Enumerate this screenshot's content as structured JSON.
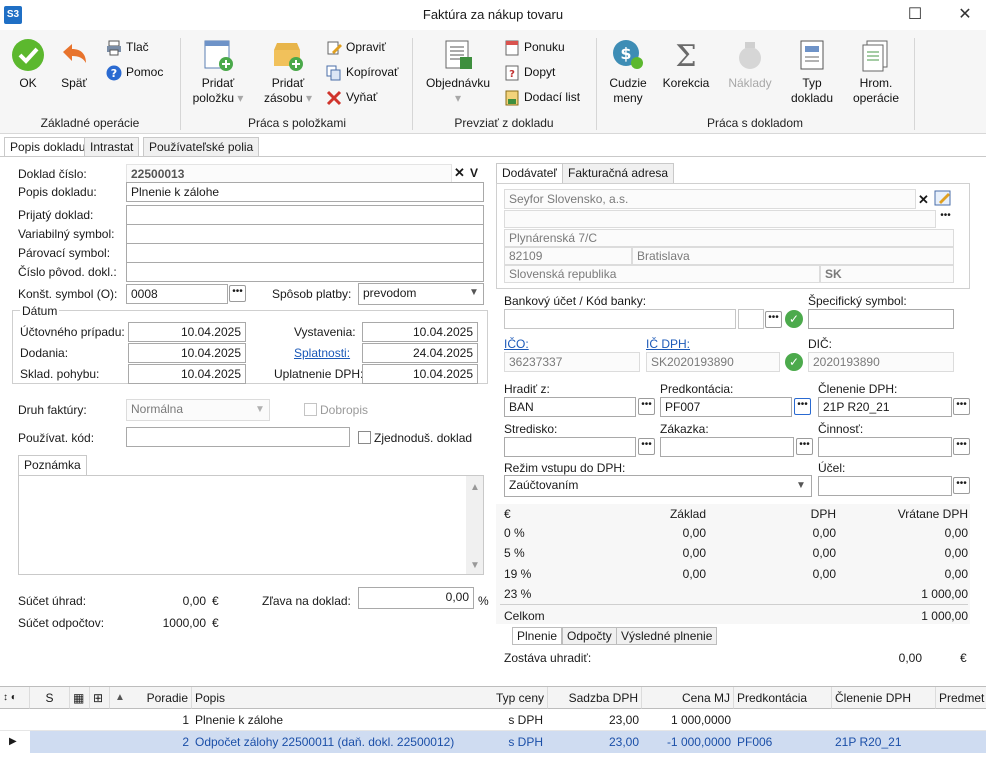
{
  "window": {
    "logo": "S3",
    "title": "Faktúra za nákup tovaru"
  },
  "ribbon": {
    "ok": "OK",
    "back": "Späť",
    "print": "Tlač",
    "help": "Pomoc",
    "add_item_l1": "Pridať",
    "add_item_l2": "položku",
    "add_stock_l1": "Pridať",
    "add_stock_l2": "zásobu",
    "edit": "Opraviť",
    "copy": "Kopírovať",
    "cut": "Vyňať",
    "order": "Objednávku",
    "offer": "Ponuku",
    "inquiry": "Dopyt",
    "delivery_note": "Dodací list",
    "currency_l1": "Cudzie",
    "currency_l2": "meny",
    "correction": "Korekcia",
    "costs": "Náklady",
    "doc_type_l1": "Typ",
    "doc_type_l2": "dokladu",
    "bulk_l1": "Hrom.",
    "bulk_l2": "operácie",
    "groups": {
      "basic": "Základné operácie",
      "items": "Práca s položkami",
      "import": "Prevziať z dokladu",
      "document": "Práca s dokladom"
    }
  },
  "tabs": {
    "description": "Popis dokladu",
    "intrastat": "Intrastat",
    "user_fields": "Používateľské polia"
  },
  "form": {
    "doc_number_label": "Doklad číslo:",
    "doc_number": "22500013",
    "doc_desc_label": "Popis dokladu:",
    "doc_desc": "Plnenie k zálohe",
    "received_label": "Prijatý doklad:",
    "variable_label": "Variabilný symbol:",
    "pairing_label": "Párovací symbol:",
    "orig_label": "Číslo pôvod. dokl.:",
    "const_label": "Konšt. symbol (O):",
    "const_value": "0008",
    "payment_label": "Spôsob platby:",
    "payment_value": "prevodom",
    "date_group": "Dátum",
    "accounting_label": "Účtovného prípadu:",
    "accounting_date": "10.04.2025",
    "delivery_label": "Dodania:",
    "delivery_date": "10.04.2025",
    "stock_label": "Sklad. pohybu:",
    "stock_date": "10.04.2025",
    "issue_label": "Vystavenia:",
    "issue_date": "10.04.2025",
    "due_label": "Splatnosti:",
    "due_date": "24.04.2025",
    "vat_claim_label": "Uplatnenie DPH:",
    "vat_claim_date": "10.04.2025",
    "invoice_kind_label": "Druh faktúry:",
    "invoice_kind": "Normálna",
    "credit_note": "Dobropis",
    "user_code_label": "Používat. kód:",
    "simplified": "Zjednoduš. doklad",
    "note_tab": "Poznámka",
    "payments_sum_label": "Súčet úhrad:",
    "payments_sum": "0,00",
    "payments_cur": "€",
    "deductions_label": "Súčet odpočtov:",
    "deductions_sum": "1000,00",
    "deductions_cur": "€",
    "discount_label": "Zľava na doklad:",
    "discount": "0,00",
    "discount_unit": "%"
  },
  "supplier": {
    "tab_supplier": "Dodávateľ",
    "tab_billing": "Fakturačná adresa",
    "name": "Seyfor Slovensko, a.s.",
    "street": "Plynárenská 7/C",
    "zip": "82109",
    "city": "Bratislava",
    "country": "Slovenská republika",
    "country_code": "SK",
    "bank_label": "Bankový účet / Kód banky:",
    "specific_label": "Špecifický symbol:",
    "ico_label": "IČO:",
    "ico": "36237337",
    "icdph_label": "IČ DPH:",
    "icdph": "SK2020193890",
    "dic_label": "DIČ:",
    "dic": "2020193890",
    "pay_from_label": "Hradiť z:",
    "pay_from": "BAN",
    "precontation_label": "Predkontácia:",
    "precontation": "PF007",
    "vat_split_label": "Členenie DPH:",
    "vat_split": "21P R20_21",
    "centre_label": "Stredisko:",
    "order_label": "Zákazka:",
    "activity_label": "Činnosť:",
    "vat_regime_label": "Režim vstupu do DPH:",
    "vat_regime": "Zaúčtovaním",
    "purpose_label": "Účel:"
  },
  "vat_table": {
    "headers": [
      "€",
      "Základ",
      "DPH",
      "Vrátane DPH"
    ],
    "rows": [
      {
        "rate": "0 %",
        "base": "0,00",
        "vat": "0,00",
        "total": "0,00"
      },
      {
        "rate": "5 %",
        "base": "0,00",
        "vat": "0,00",
        "total": "0,00"
      },
      {
        "rate": "19 %",
        "base": "0,00",
        "vat": "0,00",
        "total": "0,00"
      },
      {
        "rate": "23 %",
        "base": "",
        "vat": "",
        "total": "1 000,00"
      }
    ],
    "total_label": "Celkom",
    "total": "1 000,00",
    "subtabs": [
      "Plnenie",
      "Odpočty",
      "Výsledné plnenie"
    ],
    "remaining_label": "Zostáva uhradiť:",
    "remaining": "0,00",
    "remaining_cur": "€"
  },
  "grid": {
    "headers": {
      "s": "S",
      "order": "Poradie",
      "desc": "Popis",
      "price_type": "Typ ceny",
      "vat_rate": "Sadzba DPH",
      "unit_price": "Cena MJ",
      "precontation": "Predkontácia",
      "vat_split": "Členenie DPH",
      "subject": "Predmet"
    },
    "rows": [
      {
        "order": "1",
        "desc": "Plnenie k zálohe",
        "price_type": "s DPH",
        "vat_rate": "23,00",
        "unit_price": "1 000,0000",
        "precontation": "",
        "vat_split": ""
      },
      {
        "order": "2",
        "desc": "Odpočet zálohy 22500011 (daň. dokl. 22500012)",
        "price_type": "s DPH",
        "vat_rate": "23,00",
        "unit_price": "-1 000,0000",
        "precontation": "PF006",
        "vat_split": "21P R20_21"
      }
    ]
  }
}
